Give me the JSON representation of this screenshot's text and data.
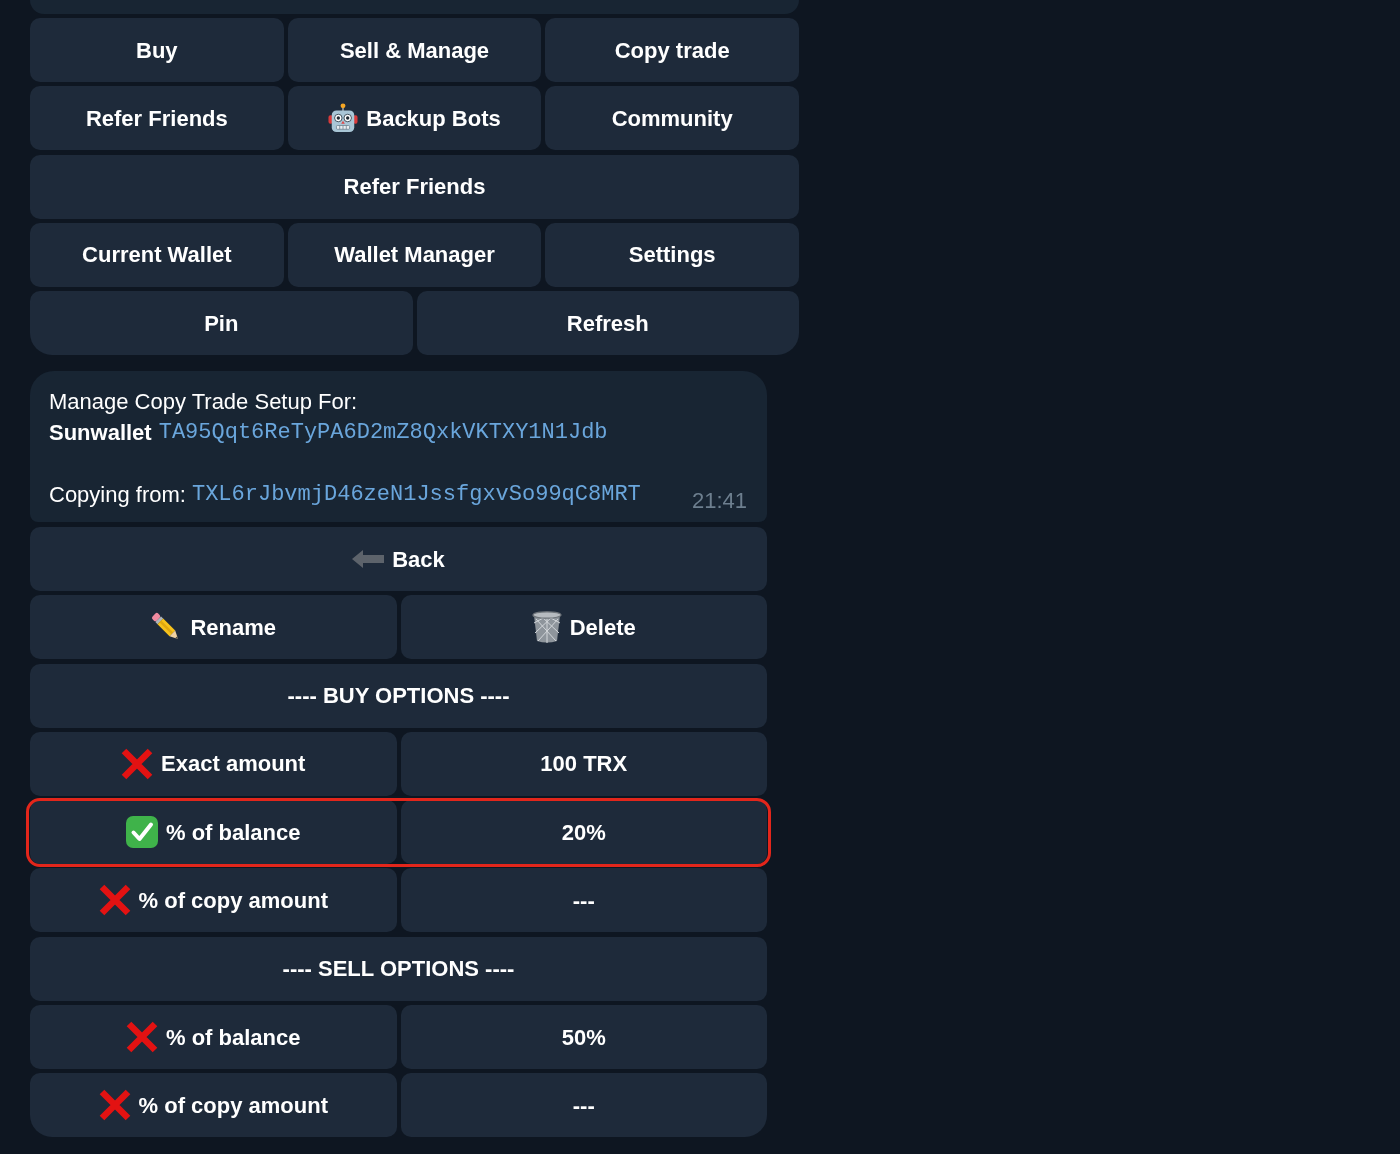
{
  "main_keyboard": {
    "rows": [
      {
        "buttons": [
          {
            "label": "Buy",
            "kind": "plain"
          },
          {
            "label": "Sell & Manage",
            "kind": "plain"
          },
          {
            "label": "Copy trade",
            "kind": "plain"
          }
        ]
      },
      {
        "buttons": [
          {
            "label": "Refer Friends",
            "kind": "plain"
          },
          {
            "label": "Backup Bots",
            "kind": "bots"
          },
          {
            "label": "Community",
            "kind": "plain"
          }
        ]
      },
      {
        "buttons": [
          {
            "label": "Refer Friends",
            "kind": "plain"
          }
        ]
      },
      {
        "buttons": [
          {
            "label": "Current Wallet",
            "kind": "plain"
          },
          {
            "label": "Wallet Manager",
            "kind": "plain"
          },
          {
            "label": "Settings",
            "kind": "plain"
          }
        ]
      },
      {
        "buttons": [
          {
            "label": "Pin",
            "kind": "plain"
          },
          {
            "label": "Refresh",
            "kind": "plain"
          }
        ]
      }
    ]
  },
  "message": {
    "title": "Manage Copy Trade Setup For:",
    "wallet_name": "Sunwallet",
    "wallet_address": "TA95Qqt6ReTyPA6D2mZ8QxkVKTXY1N1Jdb",
    "copying_label": "Copying from:",
    "copying_address": "TXL6rJbvmjD46zeN1JssfgxvSo99qC8MRT",
    "time": "21:41"
  },
  "settings_keyboard": {
    "rows": [
      {
        "kind": "buttons",
        "buttons": [
          {
            "label": "Back",
            "kind": "back"
          }
        ]
      },
      {
        "kind": "buttons",
        "buttons": [
          {
            "label": "Rename",
            "kind": "rename"
          },
          {
            "label": "Delete",
            "kind": "delete"
          }
        ]
      },
      {
        "kind": "header",
        "label": "---- BUY OPTIONS ----"
      },
      {
        "kind": "option",
        "label": "Exact amount",
        "checked": false,
        "value": "100 TRX",
        "highlighted": false
      },
      {
        "kind": "option",
        "label": "% of balance",
        "checked": true,
        "value": "20%",
        "highlighted": true
      },
      {
        "kind": "option",
        "label": "% of copy amount",
        "checked": false,
        "value": "---",
        "highlighted": false
      },
      {
        "kind": "header",
        "label": "---- SELL OPTIONS ----"
      },
      {
        "kind": "option",
        "label": "% of balance",
        "checked": false,
        "value": "50%",
        "highlighted": false
      },
      {
        "kind": "option",
        "label": "% of copy amount",
        "checked": false,
        "value": "---",
        "highlighted": false
      }
    ]
  }
}
